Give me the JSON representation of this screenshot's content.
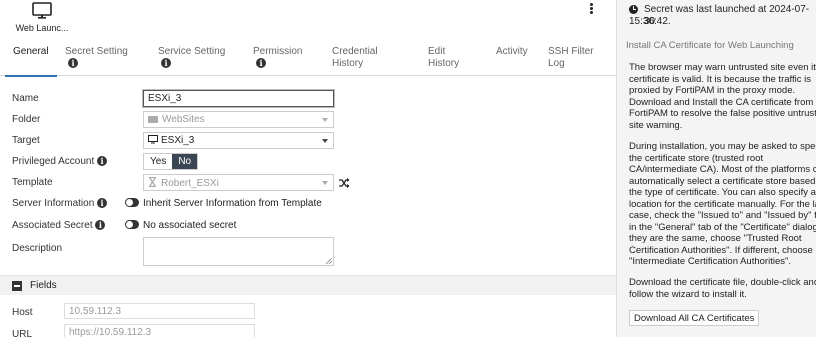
{
  "toolbar": {
    "launch_label": "Web Launc...",
    "launch_icon": "monitor-icon",
    "menu_icon": "kebab-menu-icon"
  },
  "tabs": [
    {
      "label": "General",
      "active": true
    },
    {
      "label": "Secret Setting",
      "has_info": true
    },
    {
      "label": "Service Setting",
      "has_info": true
    },
    {
      "label": "Permission",
      "has_info": true
    },
    {
      "label": "Credential History"
    },
    {
      "label": "Edit History"
    },
    {
      "label": "Activity"
    },
    {
      "label": "SSH Filter Log"
    }
  ],
  "form": {
    "name_label": "Name",
    "name_value": "ESXi_3",
    "folder_label": "Folder",
    "folder_value": "WebSites",
    "target_label": "Target",
    "target_value": "ESXi_3",
    "privileged_label": "Privileged Account",
    "privileged_yes": "Yes",
    "privileged_no": "No",
    "template_label": "Template",
    "template_value": "Robert_ESXi",
    "server_info_label": "Server Information",
    "server_info_text": "Inherit Server Information from Template",
    "associated_label": "Associated Secret",
    "associated_text": "No associated secret",
    "description_label": "Description"
  },
  "fields_section": {
    "title": "Fields",
    "host_label": "Host",
    "host_value": "10.59.112.3",
    "url_label": "URL",
    "url_value": "https://10.59.112.3"
  },
  "side": {
    "last_launched": "Secret was last launched at 2024-07-30",
    "last_launched_time": "15:36:42.",
    "title": "Install CA Certificate for Web Launching",
    "para1": "The browser may warn untrusted site even its\ncertificate is valid. It is because the traffic is\nproxied by FortiPAM in the proxy mode.\nDownload and Install the CA certificate from\nFortiPAM to resolve the false positive untrust\nsite warning.",
    "para2": "During installation, you may be asked to speci\nthe certificate store (trusted root\nCA/intermediate CA). Most of the platforms c\nautomatically select a certificate store based\nthe type of certificate. You can also specify a\nlocation for the certificate manually. For the la\ncase, check the \"Issued to\" and \"Issued by\" fie\nin the \"General\" tab of the \"Certificate\" dialog\nthey are the same, choose \"Trusted Root\nCertification Authorities\". If different, choose\n\"Intermediate Certification Authorities\".",
    "para3": "Download the certificate file, double-click and\nfollow the wizard to install it.",
    "download_button": "Download All CA Certificates"
  }
}
